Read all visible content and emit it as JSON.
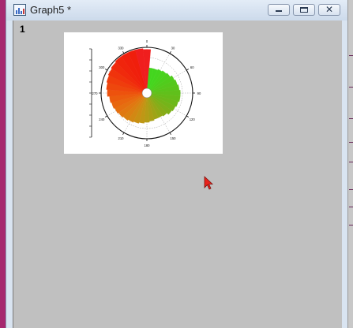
{
  "window": {
    "title": "Graph5 *",
    "page_number": "1"
  },
  "colors": {
    "frame": "#a6286f",
    "workspace": "#c0c0c0",
    "cursor": "#e8231c"
  },
  "icons": [
    "graph-app-icon",
    "minimize-icon",
    "restore-icon",
    "close-icon",
    "arrow-cursor-icon"
  ],
  "chart_data": {
    "type": "polar-bar",
    "angular_tick_labels": [
      "0",
      "30",
      "60",
      "90",
      "120",
      "150",
      "180",
      "210",
      "240",
      "270",
      "300",
      "330"
    ],
    "sectors": [
      {
        "angle": 0,
        "value": 3.8,
        "color": "#f01e1e"
      },
      {
        "angle": 10,
        "value": 2.0,
        "color": "#43d61e"
      },
      {
        "angle": 20,
        "value": 2.0,
        "color": "#43d61e"
      },
      {
        "angle": 30,
        "value": 2.1,
        "color": "#45d51e"
      },
      {
        "angle": 40,
        "value": 2.2,
        "color": "#48d31d"
      },
      {
        "angle": 50,
        "value": 2.3,
        "color": "#4ccf1d"
      },
      {
        "angle": 60,
        "value": 2.5,
        "color": "#50cc1c"
      },
      {
        "angle": 70,
        "value": 2.6,
        "color": "#55c81c"
      },
      {
        "angle": 80,
        "value": 2.7,
        "color": "#5ac41b"
      },
      {
        "angle": 90,
        "value": 2.8,
        "color": "#60c01b"
      },
      {
        "angle": 100,
        "value": 2.8,
        "color": "#66bc1a"
      },
      {
        "angle": 110,
        "value": 2.7,
        "color": "#6db81a"
      },
      {
        "angle": 120,
        "value": 2.6,
        "color": "#75b419"
      },
      {
        "angle": 130,
        "value": 2.5,
        "color": "#7eb019"
      },
      {
        "angle": 140,
        "value": 2.3,
        "color": "#88ac18"
      },
      {
        "angle": 150,
        "value": 2.2,
        "color": "#93a817"
      },
      {
        "angle": 160,
        "value": 2.2,
        "color": "#9ea417"
      },
      {
        "angle": 170,
        "value": 2.3,
        "color": "#a9a016"
      },
      {
        "angle": 180,
        "value": 2.4,
        "color": "#b49c16"
      },
      {
        "angle": 190,
        "value": 2.5,
        "color": "#bf9715"
      },
      {
        "angle": 200,
        "value": 2.6,
        "color": "#c99014"
      },
      {
        "angle": 210,
        "value": 2.7,
        "color": "#d28813"
      },
      {
        "angle": 220,
        "value": 2.8,
        "color": "#da8012"
      },
      {
        "angle": 230,
        "value": 2.9,
        "color": "#e07811"
      },
      {
        "angle": 240,
        "value": 3.0,
        "color": "#e56f10"
      },
      {
        "angle": 250,
        "value": 3.1,
        "color": "#e8660f"
      },
      {
        "angle": 260,
        "value": 3.2,
        "color": "#eb5c0e"
      },
      {
        "angle": 270,
        "value": 3.4,
        "color": "#ed520d"
      },
      {
        "angle": 280,
        "value": 3.5,
        "color": "#ee470d"
      },
      {
        "angle": 290,
        "value": 3.6,
        "color": "#ef3d0c"
      },
      {
        "angle": 300,
        "value": 3.7,
        "color": "#f0330c"
      },
      {
        "angle": 310,
        "value": 3.8,
        "color": "#f02a0c"
      },
      {
        "angle": 320,
        "value": 3.9,
        "color": "#f0240c"
      },
      {
        "angle": 330,
        "value": 3.9,
        "color": "#f0200c"
      },
      {
        "angle": 340,
        "value": 3.9,
        "color": "#f01e0c"
      },
      {
        "angle": 350,
        "value": 3.9,
        "color": "#f01e1e"
      }
    ],
    "rmax": 4,
    "grid": true
  }
}
